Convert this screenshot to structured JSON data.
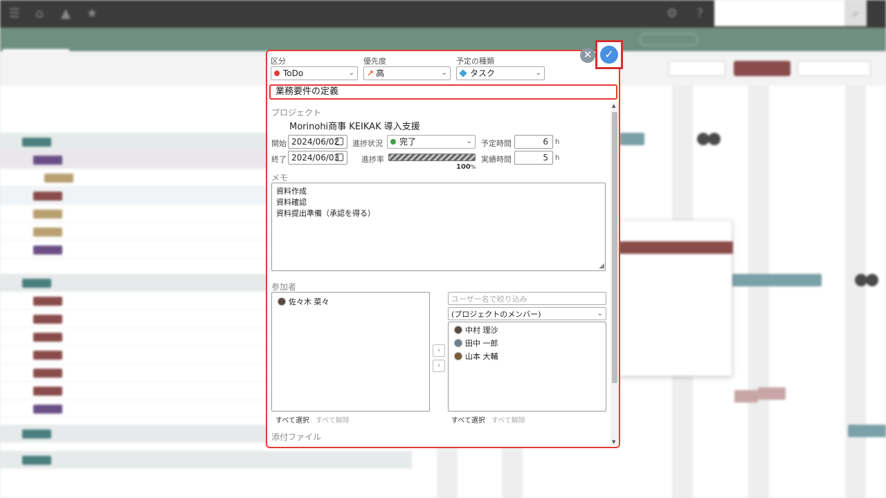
{
  "modal": {
    "category": {
      "label": "区分",
      "value": "ToDo",
      "color": "#e53935"
    },
    "priority": {
      "label": "優先度",
      "value": "高",
      "icon": "arrow-up-right-icon",
      "color": "#e6642e"
    },
    "event_type": {
      "label": "予定の種類",
      "value": "タスク",
      "icon": "cube-icon",
      "color": "#3fa2d8"
    },
    "title_value": "業務要件の定義",
    "project_label": "プロジェクト",
    "project_name": "Morinohi商事 KEIKAK 導入支援",
    "start_label": "開始",
    "start_date": "2024/06/02",
    "end_label": "終了",
    "end_date": "2024/06/03",
    "status_label": "進捗状況",
    "status_value": "完了",
    "status_color": "#43a047",
    "progress_label": "進捗率",
    "progress_percent": 100,
    "progress_value": "100",
    "progress_unit": "%",
    "planned_label": "予定時間",
    "planned_hours": "6",
    "actual_label": "実績時間",
    "actual_hours": "5",
    "hour_unit": "h",
    "memo_label": "メモ",
    "memo_lines": [
      "資料作成",
      "資料確認",
      "資料提出準備（承認を得る）"
    ],
    "participants_label": "参加者",
    "participants": [
      "佐々木 菜々"
    ],
    "filter_placeholder": "ユーザー名で絞り込み",
    "member_filter": "(プロジェクトのメンバー)",
    "available_members": [
      "中村 理沙",
      "田中 一郎",
      "山本 大輔"
    ],
    "select_all": "すべて選択",
    "deselect_all": "すべて解除",
    "attachments_label": "添付ファイル",
    "close_icon": "close-icon",
    "confirm_icon": "check-icon"
  }
}
